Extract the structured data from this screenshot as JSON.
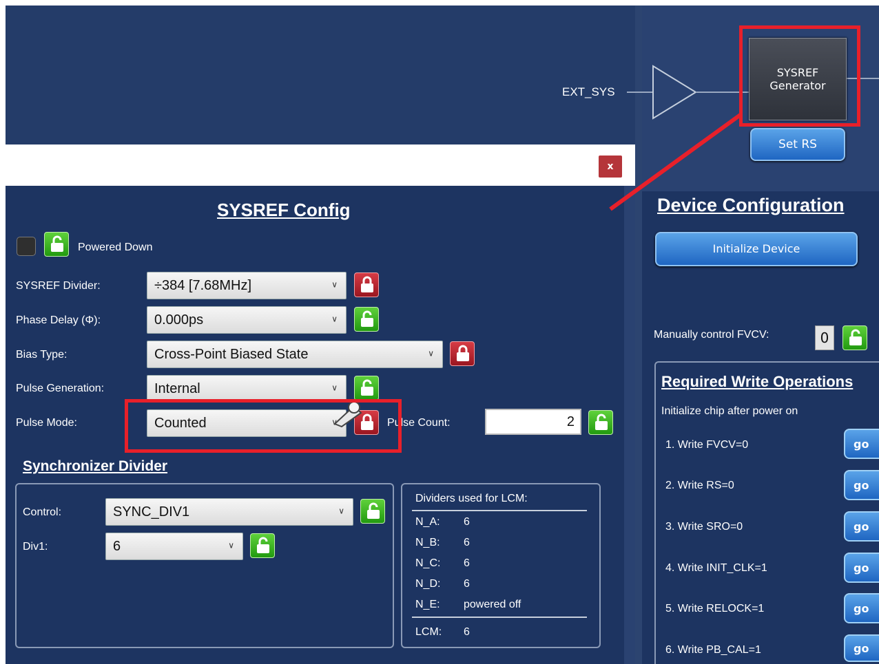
{
  "diagram": {
    "ext_sys_label": "EXT_SYS",
    "generator_line1": "SYSREF",
    "generator_line2": "Generator",
    "set_rs_label": "Set RS"
  },
  "dialog": {
    "close_label": "x",
    "title": "SYSREF Config",
    "powered_down_label": "Powered Down",
    "rows": {
      "sysref_divider": {
        "label": "SYSREF Divider:",
        "value": "÷384 [7.68MHz]"
      },
      "phase_delay": {
        "label": "Phase Delay (Φ):",
        "value": "0.000ps"
      },
      "bias_type": {
        "label": "Bias Type:",
        "value": "Cross-Point Biased State"
      },
      "pulse_generation": {
        "label": "Pulse Generation:",
        "value": "Internal"
      },
      "pulse_mode": {
        "label": "Pulse Mode:",
        "value": "Counted"
      }
    },
    "pulse_count": {
      "label": "Pulse Count:",
      "value": "2"
    },
    "sync_divider": {
      "title": "Synchronizer Divider",
      "control_label": "Control:",
      "control_value": "SYNC_DIV1",
      "div1_label": "Div1:",
      "div1_value": "6"
    },
    "lcm": {
      "title": "Dividers used for LCM:",
      "items": [
        {
          "name": "N_A:",
          "value": "6"
        },
        {
          "name": "N_B:",
          "value": "6"
        },
        {
          "name": "N_C:",
          "value": "6"
        },
        {
          "name": "N_D:",
          "value": "6"
        },
        {
          "name": "N_E:",
          "value": "powered off"
        }
      ],
      "lcm_label": "LCM:",
      "lcm_value": "6"
    }
  },
  "device_config": {
    "title": "Device Configuration",
    "initialize_button": "Initialize Device",
    "fvcv_label": "Manually control FVCV:",
    "fvcv_value": "0",
    "required_title": "Required Write Operations",
    "required_subtitle": "Initialize chip after power on",
    "steps": [
      {
        "text": "1.  Write FVCV=0",
        "go": "go"
      },
      {
        "text": "2.  Write RS=0",
        "go": "go"
      },
      {
        "text": "3.  Write SRO=0",
        "go": "go"
      },
      {
        "text": "4.  Write INIT_CLK=1",
        "go": "go"
      },
      {
        "text": "5.  Write RELOCK=1",
        "go": "go"
      },
      {
        "text": "6.  Write PB_CAL=1",
        "go": "go"
      }
    ]
  },
  "colors": {
    "annotation_red": "#e8202a",
    "panel_navy": "#1d3461",
    "lock_green": "#3dbb23",
    "lock_red": "#c02a33",
    "button_blue": "#2f7bd4"
  }
}
